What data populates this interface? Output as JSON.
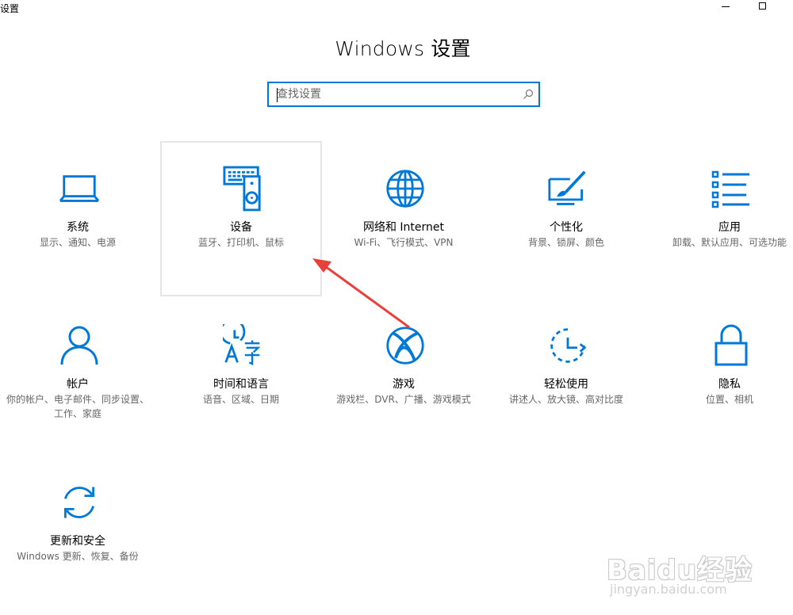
{
  "window": {
    "title": "设置"
  },
  "header": {
    "title": "Windows 设置"
  },
  "search": {
    "placeholder": "查找设置"
  },
  "tiles": [
    {
      "name": "系统",
      "desc": "显示、通知、电源",
      "icon": "laptop-icon"
    },
    {
      "name": "设备",
      "desc": "蓝牙、打印机、鼠标",
      "icon": "keyboard-speaker-icon",
      "selected": true
    },
    {
      "name": "网络和 Internet",
      "desc": "Wi-Fi、飞行模式、VPN",
      "icon": "globe-icon"
    },
    {
      "name": "个性化",
      "desc": "背景、锁屏、颜色",
      "icon": "paint-brush-icon"
    },
    {
      "name": "应用",
      "desc": "卸载、默认应用、可选功能",
      "icon": "apps-list-icon"
    },
    {
      "name": "帐户",
      "desc": "你的帐户、电子邮件、同步设置、工作、家庭",
      "icon": "person-icon"
    },
    {
      "name": "时间和语言",
      "desc": "语音、区域、日期",
      "icon": "time-language-icon"
    },
    {
      "name": "游戏",
      "desc": "游戏栏、DVR、广播、游戏模式",
      "icon": "xbox-icon"
    },
    {
      "name": "轻松使用",
      "desc": "讲述人、放大镜、高对比度",
      "icon": "ease-of-access-icon"
    },
    {
      "name": "隐私",
      "desc": "位置、相机",
      "icon": "lock-icon"
    },
    {
      "name": "更新和安全",
      "desc": "Windows 更新、恢复、备份",
      "icon": "sync-icon"
    }
  ],
  "watermark": {
    "logo": "Baidu经验",
    "url": "jingyan.baidu.com"
  },
  "colors": {
    "accent": "#0078d7",
    "annotation_arrow": "#e8413c",
    "desc_text": "#666666"
  }
}
